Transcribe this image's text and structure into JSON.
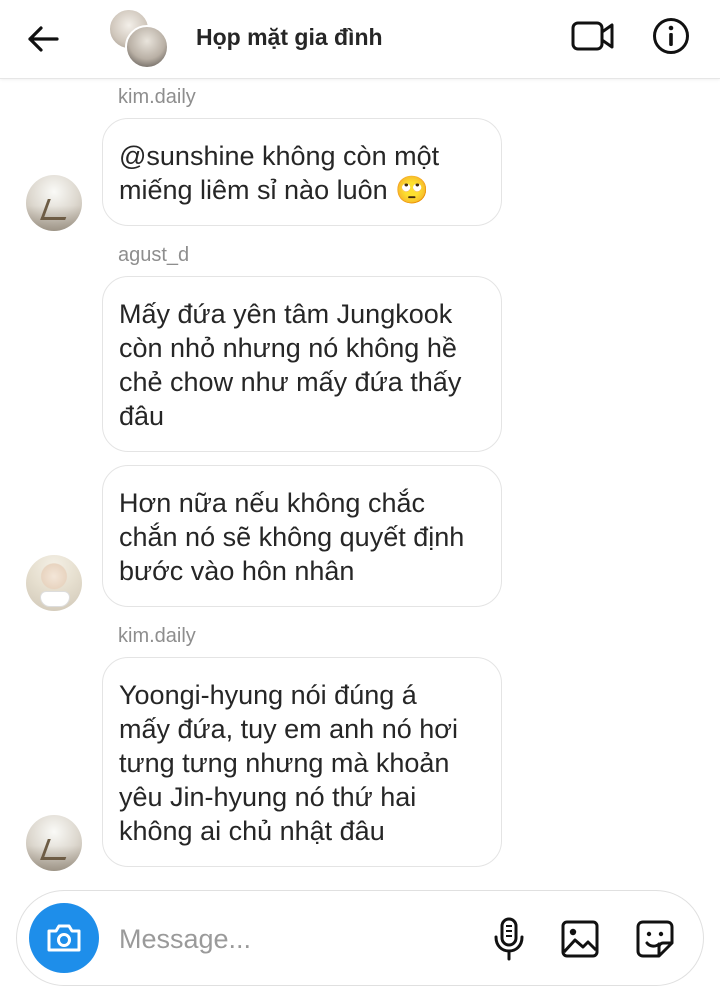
{
  "header": {
    "title": "Họp mặt gia đình",
    "back_icon": "arrow-left-icon",
    "video_icon": "video-call-icon",
    "info_icon": "info-icon"
  },
  "messages": [
    {
      "sender": "kim.daily",
      "text": "@sunshine không còn một\nmiếng liêm sỉ nào luôn 🙄"
    },
    {
      "sender": "agust_d",
      "text": "Mấy đứa yên tâm Jungkook\ncòn nhỏ nhưng nó không hề\nchẻ chow như mấy đứa thấy\nđâu"
    },
    {
      "sender": "",
      "text": "Hơn nữa nếu không chắc\nchắn nó sẽ không quyết định\nbước vào hôn nhân"
    },
    {
      "sender": "kim.daily",
      "text": "Yoongi-hyung nói đúng á\nmấy đứa, tuy em anh nó hơi\ntưng tưng nhưng mà khoản\nyêu Jin-hyung nó thứ hai\nkhông ai chủ nhật đâu"
    }
  ],
  "composer": {
    "placeholder": "Message...",
    "value": "",
    "camera_icon": "camera-icon",
    "mic_icon": "microphone-icon",
    "gallery_icon": "gallery-icon",
    "sticker_icon": "sticker-icon"
  },
  "colors": {
    "accent": "#1e8eea",
    "text": "#262626",
    "muted": "#8e8e8e",
    "bubble_border": "#e4e4e4"
  }
}
